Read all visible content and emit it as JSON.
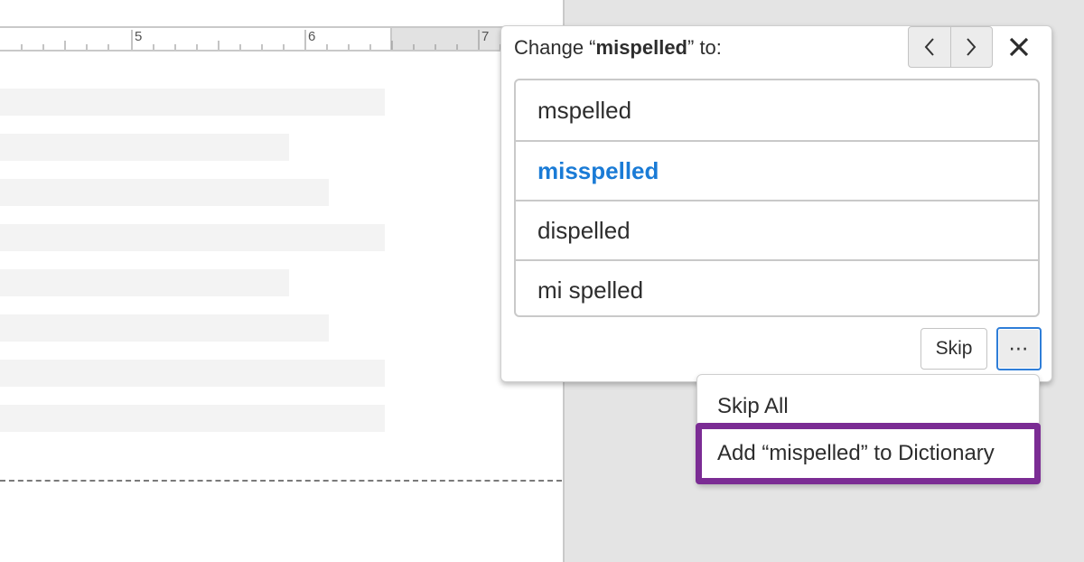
{
  "ruler": {
    "labels": [
      "5",
      "6",
      "7"
    ]
  },
  "spellcheck": {
    "title_prefix": "Change “",
    "misspelled_word": "mispelled",
    "title_suffix": "” to:",
    "prev_icon": "chevron-left-icon",
    "next_icon": "chevron-right-icon",
    "close_icon": "close-icon",
    "suggestions": [
      {
        "label": "mspelled",
        "selected": false
      },
      {
        "label": "misspelled",
        "selected": true
      },
      {
        "label": "dispelled",
        "selected": false
      },
      {
        "label": "mi spelled",
        "selected": false
      }
    ],
    "skip_label": "Skip",
    "more_label": "⋯"
  },
  "more_menu": {
    "items": [
      {
        "label": "Skip All"
      },
      {
        "label": "Add “mispelled” to Dictionary",
        "highlighted": true
      }
    ]
  },
  "colors": {
    "selected_suggestion": "#1a7bd6",
    "highlight_border": "#7b2c94",
    "focus_border": "#2f7ed8"
  }
}
